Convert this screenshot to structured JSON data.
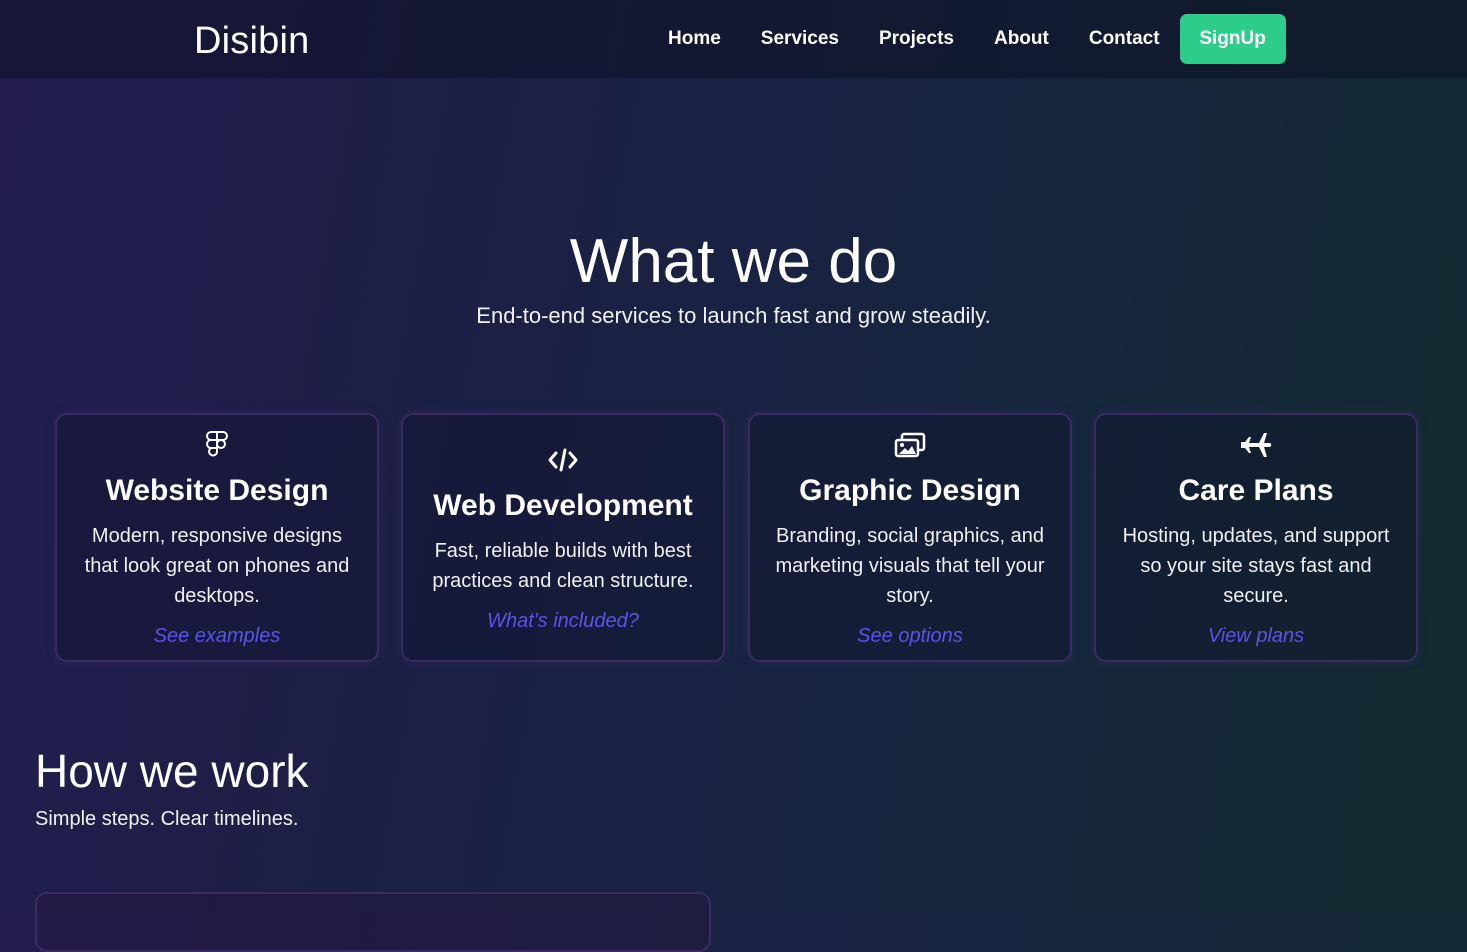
{
  "header": {
    "brand": "Disibin",
    "nav": [
      {
        "label": "Home"
      },
      {
        "label": "Services"
      },
      {
        "label": "Projects"
      },
      {
        "label": "About"
      },
      {
        "label": "Contact"
      }
    ],
    "signup_label": "SignUp"
  },
  "services": {
    "title": "What we do",
    "subtitle": "End-to-end services to launch fast and grow steadily.",
    "cards": [
      {
        "icon": "figma-icon",
        "title": "Website Design",
        "text": "Modern, responsive designs that look great on phones and desktops.",
        "link": "See examples"
      },
      {
        "icon": "code-icon",
        "title": "Web Development",
        "text": "Fast, reliable builds with best practices and clean structure.",
        "link": "What's included?"
      },
      {
        "icon": "images-icon",
        "title": "Graphic Design",
        "text": "Branding, social graphics, and marketing visuals that tell your story.",
        "link": "See options"
      },
      {
        "icon": "plane-icon",
        "title": "Care Plans",
        "text": "Hosting, updates, and support so your site stays fast and secure.",
        "link": "View plans"
      }
    ]
  },
  "process": {
    "title": "How we work",
    "subtitle": "Simple steps. Clear timelines."
  },
  "colors": {
    "accent": "#2ecc8a",
    "link": "#5b53e8",
    "card_border": "#3a2c62"
  }
}
